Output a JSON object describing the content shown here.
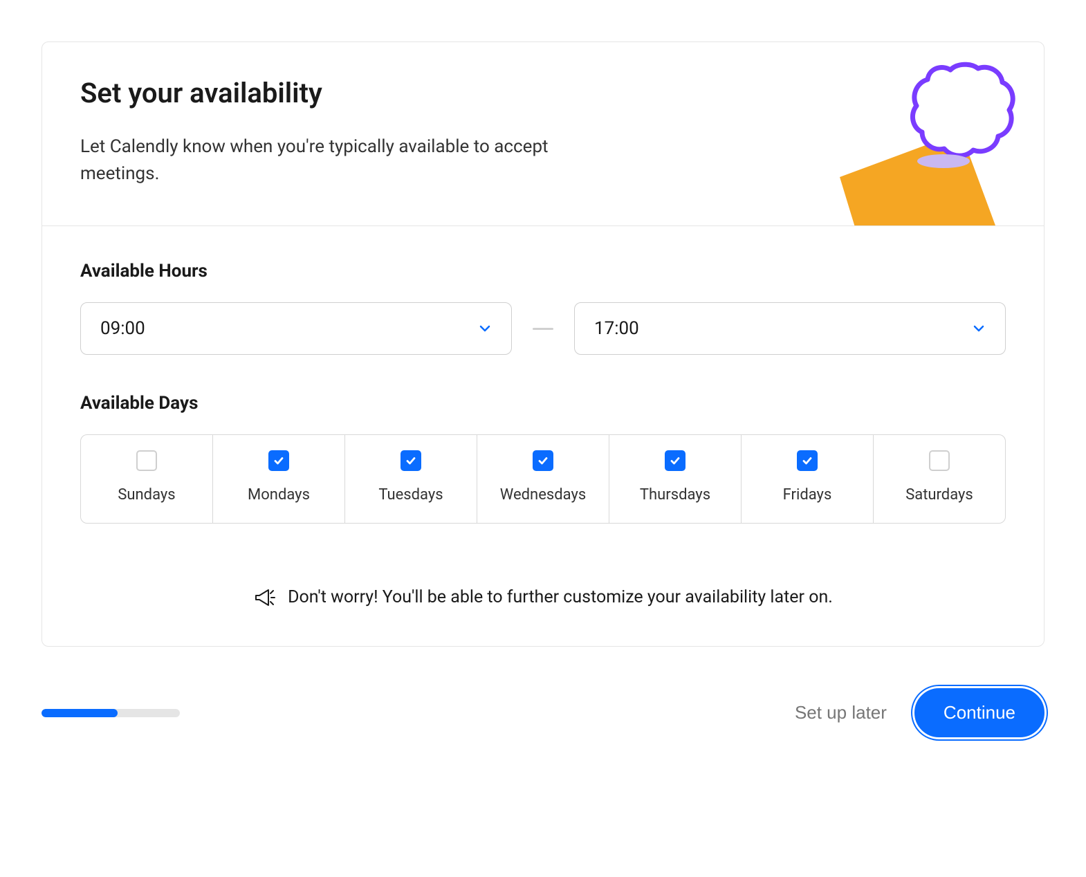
{
  "header": {
    "title": "Set your availability",
    "subtitle": "Let Calendly know when you're typically available to accept meetings."
  },
  "hours": {
    "section_label": "Available Hours",
    "start": "09:00",
    "end": "17:00"
  },
  "days": {
    "section_label": "Available Days",
    "items": [
      {
        "label": "Sundays",
        "checked": false
      },
      {
        "label": "Mondays",
        "checked": true
      },
      {
        "label": "Tuesdays",
        "checked": true
      },
      {
        "label": "Wednesdays",
        "checked": true
      },
      {
        "label": "Thursdays",
        "checked": true
      },
      {
        "label": "Fridays",
        "checked": true
      },
      {
        "label": "Saturdays",
        "checked": false
      }
    ]
  },
  "note": {
    "text": "Don't worry! You'll be able to further customize your availability later on."
  },
  "footer": {
    "progress_percent": 55,
    "setup_later_label": "Set up later",
    "continue_label": "Continue"
  },
  "colors": {
    "accent": "#0a6cff",
    "decoration_orange": "#f5a623",
    "decoration_purple": "#7a3cff"
  }
}
